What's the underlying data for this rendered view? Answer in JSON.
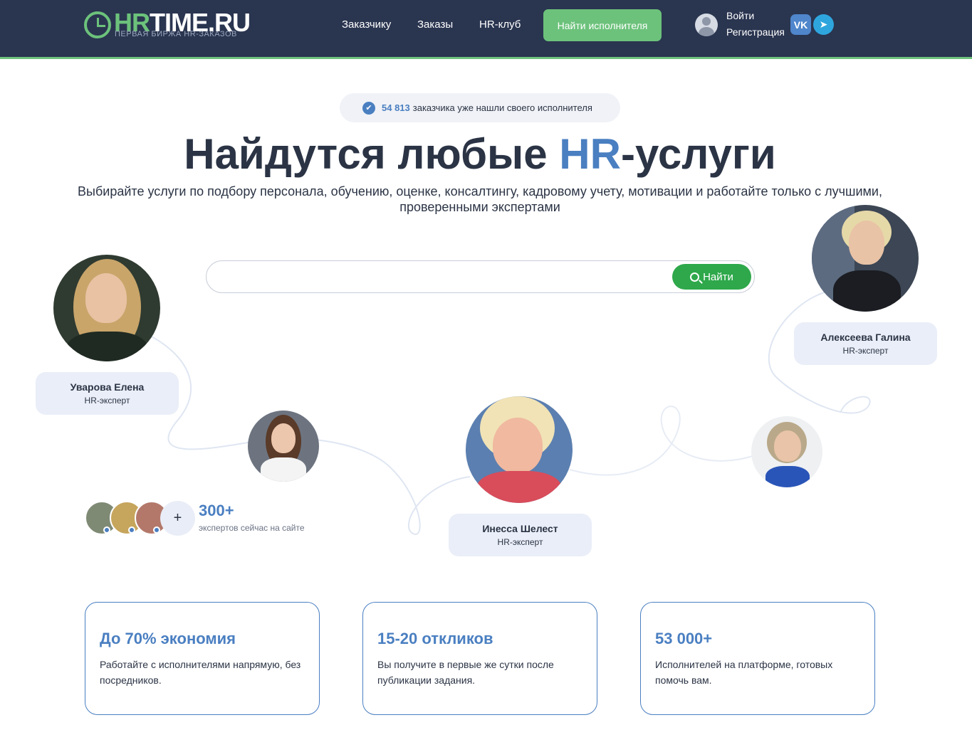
{
  "header": {
    "logo_hr": "HR",
    "logo_time": "TIME.RU",
    "logo_tagline": "ПЕРВАЯ БИРЖА HR-ЗАКАЗОВ",
    "nav": [
      "Заказчику",
      "Заказы",
      "HR-клуб"
    ],
    "cta": "Найти исполнителя",
    "login": "Войти",
    "register": "Регистрация",
    "vk_icon_glyph": "VK",
    "telegram_icon_glyph": "➤"
  },
  "hero": {
    "counter_value": "54 813",
    "counter_text": "заказчика уже нашли своего исполнителя",
    "title_before": "Найдутся любые ",
    "title_accent": "HR",
    "title_after": "-услуги",
    "subtitle": "Выбирайте услуги по подбору персонала, обучению, оценке, консалтингу, кадровому учету, мотивации и работайте только с лучшими, проверенными экспертами"
  },
  "search": {
    "placeholder": "",
    "value": "",
    "button": "Найти"
  },
  "experts": [
    {
      "name": "Уварова Елена",
      "role": "HR-эксперт"
    },
    {
      "name": "Алексеева Галина",
      "role": "HR-эксперт"
    },
    {
      "name": "Инесса Шелест",
      "role": "HR-эксперт"
    }
  ],
  "online": {
    "plus": "+",
    "count": "300+",
    "label": "экспертов сейчас на сайте"
  },
  "benefits": [
    {
      "title": "До 70% экономия",
      "text": "Работайте с исполнителями напрямую, без посредников."
    },
    {
      "title": "15-20 откликов",
      "text": "Вы получите в первые же сутки после публикации задания."
    },
    {
      "title": "53 000+",
      "text": "Исполнителей на платформе, готовых помочь вам."
    }
  ],
  "colors": {
    "header_bg": "#2a3550",
    "accent_green": "#6cc27b",
    "accent_blue": "#4a7fc1",
    "search_button": "#2ea84b"
  }
}
